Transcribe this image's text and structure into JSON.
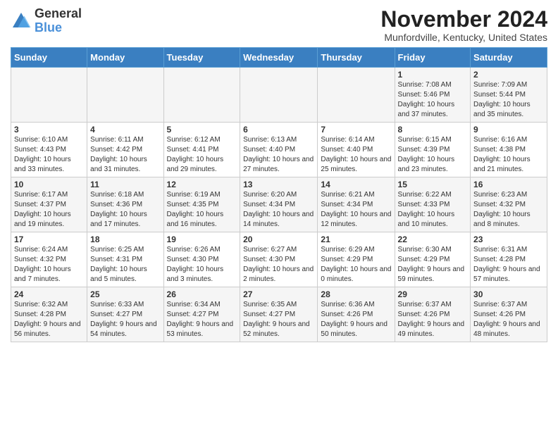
{
  "header": {
    "logo_general": "General",
    "logo_blue": "Blue",
    "month_title": "November 2024",
    "location": "Munfordville, Kentucky, United States"
  },
  "days_of_week": [
    "Sunday",
    "Monday",
    "Tuesday",
    "Wednesday",
    "Thursday",
    "Friday",
    "Saturday"
  ],
  "weeks": [
    [
      {
        "day": "",
        "info": ""
      },
      {
        "day": "",
        "info": ""
      },
      {
        "day": "",
        "info": ""
      },
      {
        "day": "",
        "info": ""
      },
      {
        "day": "",
        "info": ""
      },
      {
        "day": "1",
        "info": "Sunrise: 7:08 AM\nSunset: 5:46 PM\nDaylight: 10 hours and 37 minutes."
      },
      {
        "day": "2",
        "info": "Sunrise: 7:09 AM\nSunset: 5:44 PM\nDaylight: 10 hours and 35 minutes."
      }
    ],
    [
      {
        "day": "3",
        "info": "Sunrise: 6:10 AM\nSunset: 4:43 PM\nDaylight: 10 hours and 33 minutes."
      },
      {
        "day": "4",
        "info": "Sunrise: 6:11 AM\nSunset: 4:42 PM\nDaylight: 10 hours and 31 minutes."
      },
      {
        "day": "5",
        "info": "Sunrise: 6:12 AM\nSunset: 4:41 PM\nDaylight: 10 hours and 29 minutes."
      },
      {
        "day": "6",
        "info": "Sunrise: 6:13 AM\nSunset: 4:40 PM\nDaylight: 10 hours and 27 minutes."
      },
      {
        "day": "7",
        "info": "Sunrise: 6:14 AM\nSunset: 4:40 PM\nDaylight: 10 hours and 25 minutes."
      },
      {
        "day": "8",
        "info": "Sunrise: 6:15 AM\nSunset: 4:39 PM\nDaylight: 10 hours and 23 minutes."
      },
      {
        "day": "9",
        "info": "Sunrise: 6:16 AM\nSunset: 4:38 PM\nDaylight: 10 hours and 21 minutes."
      }
    ],
    [
      {
        "day": "10",
        "info": "Sunrise: 6:17 AM\nSunset: 4:37 PM\nDaylight: 10 hours and 19 minutes."
      },
      {
        "day": "11",
        "info": "Sunrise: 6:18 AM\nSunset: 4:36 PM\nDaylight: 10 hours and 17 minutes."
      },
      {
        "day": "12",
        "info": "Sunrise: 6:19 AM\nSunset: 4:35 PM\nDaylight: 10 hours and 16 minutes."
      },
      {
        "day": "13",
        "info": "Sunrise: 6:20 AM\nSunset: 4:34 PM\nDaylight: 10 hours and 14 minutes."
      },
      {
        "day": "14",
        "info": "Sunrise: 6:21 AM\nSunset: 4:34 PM\nDaylight: 10 hours and 12 minutes."
      },
      {
        "day": "15",
        "info": "Sunrise: 6:22 AM\nSunset: 4:33 PM\nDaylight: 10 hours and 10 minutes."
      },
      {
        "day": "16",
        "info": "Sunrise: 6:23 AM\nSunset: 4:32 PM\nDaylight: 10 hours and 8 minutes."
      }
    ],
    [
      {
        "day": "17",
        "info": "Sunrise: 6:24 AM\nSunset: 4:32 PM\nDaylight: 10 hours and 7 minutes."
      },
      {
        "day": "18",
        "info": "Sunrise: 6:25 AM\nSunset: 4:31 PM\nDaylight: 10 hours and 5 minutes."
      },
      {
        "day": "19",
        "info": "Sunrise: 6:26 AM\nSunset: 4:30 PM\nDaylight: 10 hours and 3 minutes."
      },
      {
        "day": "20",
        "info": "Sunrise: 6:27 AM\nSunset: 4:30 PM\nDaylight: 10 hours and 2 minutes."
      },
      {
        "day": "21",
        "info": "Sunrise: 6:29 AM\nSunset: 4:29 PM\nDaylight: 10 hours and 0 minutes."
      },
      {
        "day": "22",
        "info": "Sunrise: 6:30 AM\nSunset: 4:29 PM\nDaylight: 9 hours and 59 minutes."
      },
      {
        "day": "23",
        "info": "Sunrise: 6:31 AM\nSunset: 4:28 PM\nDaylight: 9 hours and 57 minutes."
      }
    ],
    [
      {
        "day": "24",
        "info": "Sunrise: 6:32 AM\nSunset: 4:28 PM\nDaylight: 9 hours and 56 minutes."
      },
      {
        "day": "25",
        "info": "Sunrise: 6:33 AM\nSunset: 4:27 PM\nDaylight: 9 hours and 54 minutes."
      },
      {
        "day": "26",
        "info": "Sunrise: 6:34 AM\nSunset: 4:27 PM\nDaylight: 9 hours and 53 minutes."
      },
      {
        "day": "27",
        "info": "Sunrise: 6:35 AM\nSunset: 4:27 PM\nDaylight: 9 hours and 52 minutes."
      },
      {
        "day": "28",
        "info": "Sunrise: 6:36 AM\nSunset: 4:26 PM\nDaylight: 9 hours and 50 minutes."
      },
      {
        "day": "29",
        "info": "Sunrise: 6:37 AM\nSunset: 4:26 PM\nDaylight: 9 hours and 49 minutes."
      },
      {
        "day": "30",
        "info": "Sunrise: 6:37 AM\nSunset: 4:26 PM\nDaylight: 9 hours and 48 minutes."
      }
    ]
  ]
}
